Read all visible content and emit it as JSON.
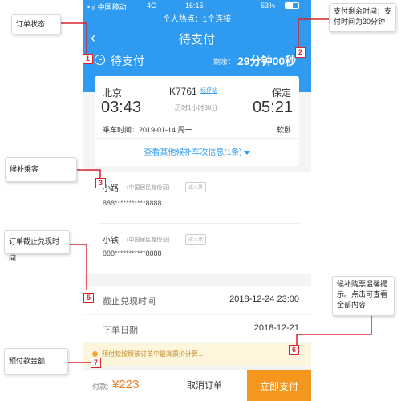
{
  "status_bar": {
    "carrier": "•ııl 中国移动",
    "network": "4G",
    "time": "16:15",
    "battery": "53%"
  },
  "hotspot": "个人热点：1个连接",
  "nav": {
    "back": "‹",
    "title": "待支付"
  },
  "order_status": {
    "label": "待支付",
    "remaining_label": "剩余：",
    "remaining_time": "29分钟00秒"
  },
  "train": {
    "from": "北京",
    "to": "保定",
    "number": "K7761",
    "via": "经停站",
    "depart_time": "03:43",
    "arrive_time": "05:21",
    "duration": "历时1小时38分",
    "travel_date": "乘车时间：2019-01-14 周一",
    "seat": "软卧",
    "more_link": "查看其他候补车次信息(1条)"
  },
  "passengers": [
    {
      "name": "小路",
      "id_type": "(中国居民身份证)",
      "tag": "成人票",
      "id_number": "888***********8888"
    },
    {
      "name": "小铁",
      "id_type": "(中国居民身份证)",
      "tag": "成人票",
      "id_number": "888***********8888"
    }
  ],
  "info": {
    "deadline_label": "截止兑现时间",
    "deadline_value": "2018-12-24 23:00",
    "order_date_label": "下单日期",
    "order_date_value": "2018-12-21"
  },
  "notice": "预付款按照该订单中最高票价计算...",
  "bottom": {
    "prepay_label": "付款:",
    "prepay_amount": "¥223",
    "cancel": "取消订单",
    "pay": "立即支付"
  },
  "annotations": [
    {
      "num": "1",
      "text": "订单状态"
    },
    {
      "num": "2",
      "text": "支付剩余时间；支付时间为30分钟"
    },
    {
      "num": "3",
      "text": "候补乘客"
    },
    {
      "num": "5",
      "text": "订单截止兑现时间"
    },
    {
      "num": "6",
      "text": "候补购票温馨提示。点击可查看全部内容"
    },
    {
      "num": "7",
      "text": "预付款金额"
    }
  ],
  "colors": {
    "primary_blue": "#2e9bf0",
    "orange": "#f5961f",
    "annotation_red": "#d9242b"
  }
}
